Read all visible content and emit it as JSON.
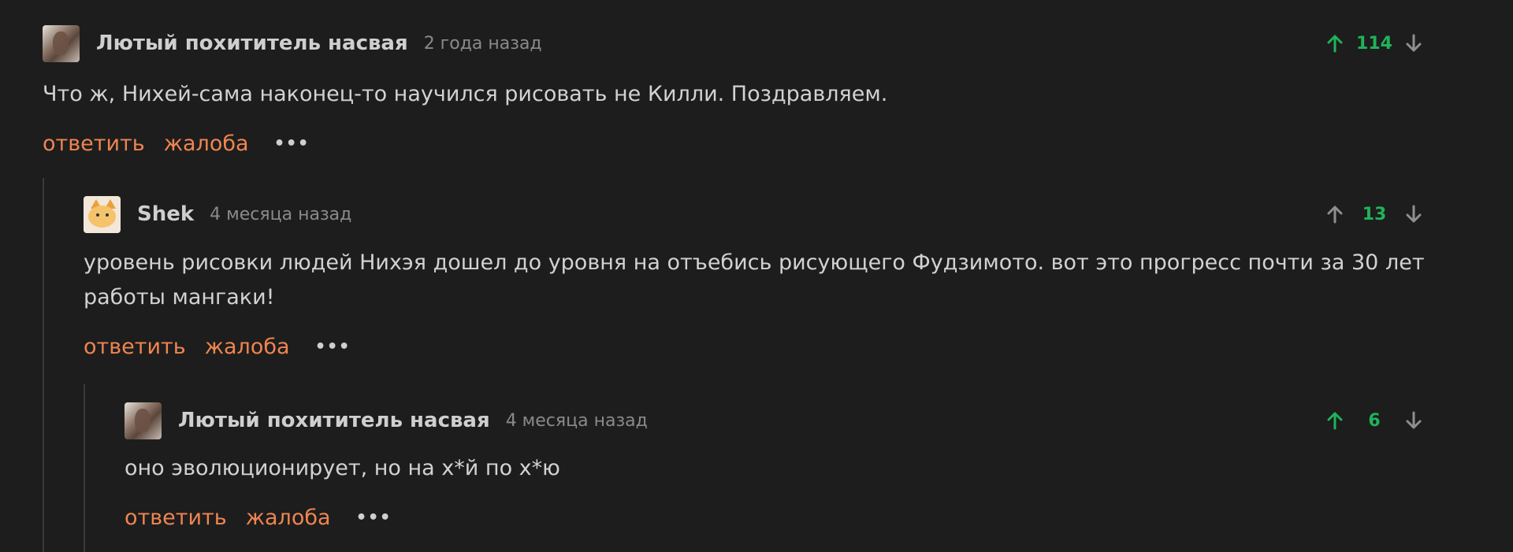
{
  "comments": [
    {
      "author": "Лютый похититель насвая",
      "time": "2 года назад",
      "score": "114",
      "text": "Что ж, Нихей-сама наконец-то научился рисовать не Килли. Поздравляем.",
      "reply_label": "ответить",
      "report_label": "жалоба",
      "more_label": "•••",
      "upvoted": true,
      "avatar_icon": "bird-avatar"
    },
    {
      "author": "Shek",
      "time": "4 месяца назад",
      "score": "13",
      "text": "уровень рисовки людей Нихэя дошел до уровня на отъебись рисующего Фудзимото. вот это прогресс почти за 30 лет работы мангаки!",
      "reply_label": "ответить",
      "report_label": "жалоба",
      "more_label": "•••",
      "upvoted": false,
      "avatar_icon": "cat-avatar"
    },
    {
      "author": "Лютый похититель насвая",
      "time": "4 месяца назад",
      "score": "6",
      "text": "оно эволюционирует, но на х*й по х*ю",
      "reply_label": "ответить",
      "report_label": "жалоба",
      "more_label": "•••",
      "upvoted": true,
      "avatar_icon": "bird-avatar"
    }
  ],
  "colors": {
    "background": "#1d1d1d",
    "score_green": "#1fb35a",
    "action_orange": "#ef8551",
    "muted": "#8a8a8a"
  }
}
